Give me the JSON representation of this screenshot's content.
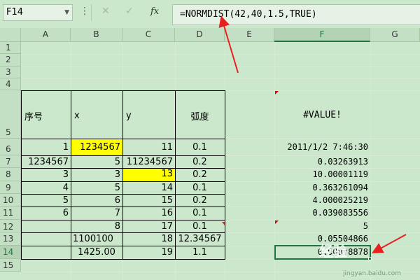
{
  "formula_bar": {
    "name_box": "F14",
    "cancel_icon": "✕",
    "enter_icon": "✓",
    "fx_label": "fx",
    "formula": "=NORMDIST(42,40,1.5,TRUE)"
  },
  "columns": [
    "A",
    "B",
    "C",
    "D",
    "E",
    "F",
    "G"
  ],
  "rows": [
    "1",
    "2",
    "3",
    "4",
    "5",
    "6",
    "7",
    "8",
    "9",
    "10",
    "11",
    "12",
    "13",
    "14",
    "15"
  ],
  "table": {
    "headers": {
      "a": "序号",
      "b": "x",
      "c": "y",
      "d": "弧度"
    },
    "f5": "#VALUE!",
    "data": [
      {
        "a": "1",
        "b": "1234567",
        "c": "11",
        "d": "0.1",
        "f": "2011/1/2  7:46:30"
      },
      {
        "a": "1234567",
        "b": "5",
        "c": "11234567",
        "d": "0.2",
        "f": "0.03263913"
      },
      {
        "a": "3",
        "b": "3",
        "c": "13",
        "d": "0.2",
        "f": "10.00001119"
      },
      {
        "a": "4",
        "b": "5",
        "c": "14",
        "d": "0.1",
        "f": "0.363261094"
      },
      {
        "a": "5",
        "b": "6",
        "c": "15",
        "d": "0.2",
        "f": "4.000025219"
      },
      {
        "a": "6",
        "b": "7",
        "c": "16",
        "d": "0.1",
        "f": "0.039083556"
      },
      {
        "a": "",
        "b": "8",
        "c": "17",
        "d": "0.1",
        "f": "5"
      },
      {
        "a": "",
        "b": "1100100",
        "c": "18",
        "d": "12.34567",
        "f": "0.05504866"
      },
      {
        "a": "",
        "b": "1425.00",
        "c": "19",
        "d": "1.1",
        "f": "0.90878878"
      }
    ]
  },
  "watermark": {
    "text": "经验",
    "site": "jingyan.baidu.com"
  },
  "colors": {
    "highlight": "#ffff00",
    "selection": "#217346",
    "annotation": "#e8201f",
    "sheet_bg": "#cbe8cc"
  }
}
